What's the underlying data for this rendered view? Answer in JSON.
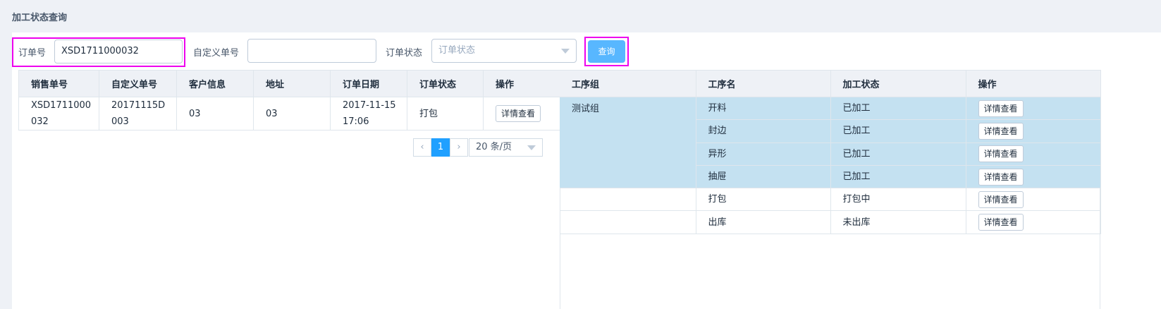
{
  "page_title": "加工状态查询",
  "search": {
    "order_no_label": "订单号",
    "order_no_value": "XSD1711000032",
    "custom_no_label": "自定义单号",
    "custom_no_value": "",
    "status_label": "订单状态",
    "status_placeholder": "订单状态",
    "query_button": "查询"
  },
  "orders_table": {
    "headers": [
      "销售单号",
      "自定义单号",
      "客户信息",
      "地址",
      "订单日期",
      "订单状态",
      "操作"
    ],
    "rows": [
      {
        "sale_no": "XSD1711000\n032",
        "custom_no": "20171115D\n003",
        "customer": "03",
        "address": "03",
        "date": "2017-11-15\n17:06",
        "status": "打包",
        "action": "详情查看"
      }
    ]
  },
  "pagination": {
    "prev": "‹",
    "current_page": "1",
    "next": "›",
    "page_size": "20 条/页"
  },
  "process_table": {
    "headers": [
      "工序组",
      "工序名",
      "加工状态",
      "操作"
    ],
    "rows": [
      {
        "group": "测试组",
        "name": "开料",
        "state": "已加工",
        "action": "详情查看"
      },
      {
        "group": "",
        "name": "封边",
        "state": "已加工",
        "action": "详情查看"
      },
      {
        "group": "",
        "name": "异形",
        "state": "已加工",
        "action": "详情查看"
      },
      {
        "group": "",
        "name": "抽屉",
        "state": "已加工",
        "action": "详情查看"
      },
      {
        "group": "",
        "name": "打包",
        "state": "打包中",
        "action": "详情查看"
      },
      {
        "group": "",
        "name": "出库",
        "state": "未出库",
        "action": "详情查看"
      }
    ]
  },
  "colors": {
    "primary_button": "#58b7ff",
    "highlight_outline": "#ee00ee",
    "selected_row": "#c4e1f1",
    "active_page": "#20a0ff"
  }
}
